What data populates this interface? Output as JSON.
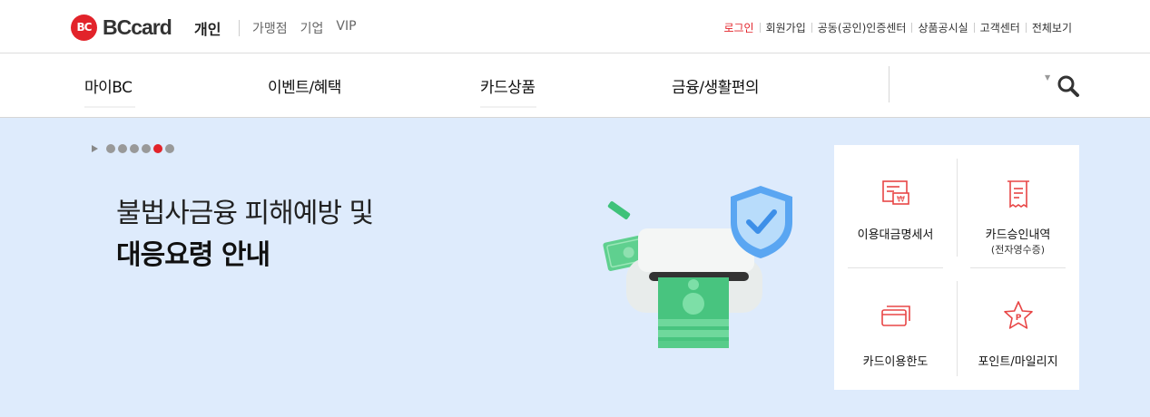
{
  "brand": {
    "logo_mark": "BC",
    "logo_text": "BCcard",
    "site": "개인"
  },
  "site_links": [
    "가맹점",
    "기업",
    "VIP"
  ],
  "util_links": [
    "로그인",
    "회원가입",
    "공동(공인)인증센터",
    "상품공시실",
    "고객센터",
    "전체보기"
  ],
  "gnb": [
    "마이BC",
    "이벤트/혜택",
    "카드상품",
    "금융/생활편의"
  ],
  "search": {
    "icon": "search-icon"
  },
  "hero": {
    "headline_line1": "불법사금융 피해예방 및",
    "headline_line2": "대응요령 안내",
    "pager": {
      "total": 6,
      "active": 5
    }
  },
  "quick_menu": [
    {
      "label": "이용대금명세서",
      "sub": "",
      "icon": "statement-icon"
    },
    {
      "label": "카드승인내역",
      "sub": "(전자영수증)",
      "icon": "receipt-icon"
    },
    {
      "label": "카드이용한도",
      "sub": "",
      "icon": "card-limit-icon"
    },
    {
      "label": "포인트/마일리지",
      "sub": "",
      "icon": "point-star-icon"
    }
  ],
  "colors": {
    "brand_red": "#e2232a",
    "hero_bg": "#deebfc",
    "icon_red": "#e84646"
  }
}
